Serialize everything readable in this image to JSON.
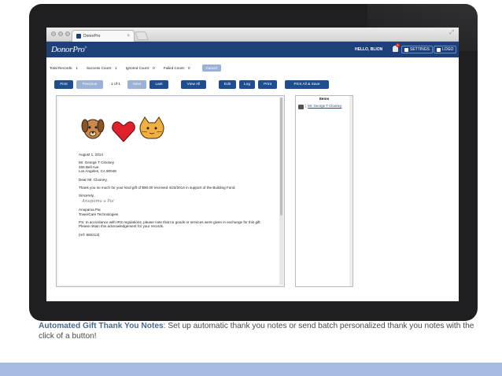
{
  "browser": {
    "tab_title": "DonorPro",
    "tab_close": "×",
    "expand_glyph": "⤢"
  },
  "app": {
    "logo": "DonorPro",
    "logo_mark": "®",
    "hello": "HELLO, BLION",
    "notification_count": "1",
    "settings_label": "SETTINGS",
    "logout_label": "LOGO",
    "brand_color": "#1d3f7a"
  },
  "stats": {
    "total_label": "Total Records:",
    "total_value": "1",
    "success_label": "Success Count:",
    "success_value": "1",
    "ignored_label": "Ignored Count:",
    "ignored_value": "0",
    "failed_label": "Failed Count:",
    "failed_value": "0",
    "cancel_label": "Cancel"
  },
  "toolbar": {
    "first": "First",
    "previous": "Previous",
    "pager": "1 of 1",
    "next": "Next",
    "last": "Last",
    "view_all": "View All",
    "edit": "Edit",
    "log": "Log",
    "print": "Print",
    "print_all_save": "Print All & Save"
  },
  "letter": {
    "date": "August 1, 2014",
    "address": [
      "Mr. George T Clooney",
      "465 Bell Ave",
      "Los Angeles, CA  90048"
    ],
    "salutation": "Dear Mr. Clooney,",
    "body": "Thank you so much for your kind gift of $90.00 received 4/23/2014 in support of the Building Fund.",
    "closing": "Sincerely,",
    "signature": "Anupama a Pai",
    "signer_name": "Anupama Pai",
    "signer_org": "TowerCare Technologies",
    "ps": "PS:  In accordance with IRS regulations, please note that no goods or services were given in exchange for this gift.  Please retain this acknowledgement for your records.",
    "ref": "(ref: 800213)"
  },
  "items": {
    "heading": "Items",
    "entries": [
      {
        "separator": "|",
        "label": "Mr. George T Clooney"
      }
    ]
  },
  "caption": {
    "bold": "Automated Gift Thank You Notes",
    "text": ": Set up automatic thank you notes or send batch personalized thank you notes with the click of a button!"
  }
}
